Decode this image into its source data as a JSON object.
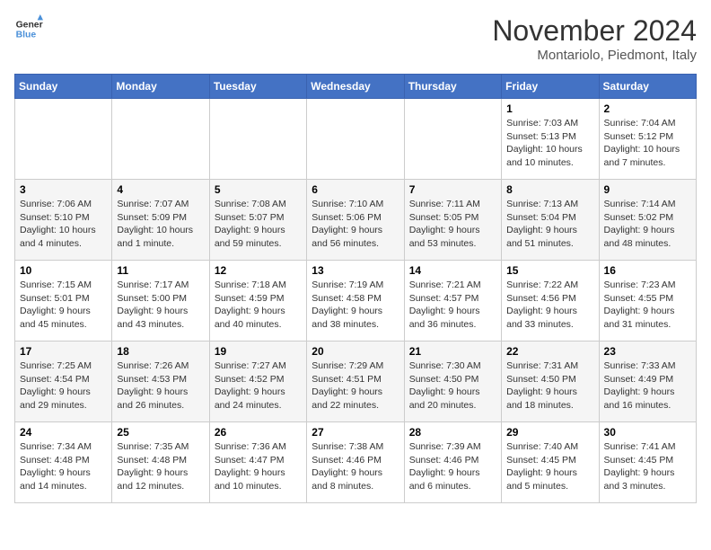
{
  "header": {
    "logo_line1": "General",
    "logo_line2": "Blue",
    "month": "November 2024",
    "location": "Montariolo, Piedmont, Italy"
  },
  "weekdays": [
    "Sunday",
    "Monday",
    "Tuesday",
    "Wednesday",
    "Thursday",
    "Friday",
    "Saturday"
  ],
  "weeks": [
    [
      {
        "day": "",
        "info": ""
      },
      {
        "day": "",
        "info": ""
      },
      {
        "day": "",
        "info": ""
      },
      {
        "day": "",
        "info": ""
      },
      {
        "day": "",
        "info": ""
      },
      {
        "day": "1",
        "info": "Sunrise: 7:03 AM\nSunset: 5:13 PM\nDaylight: 10 hours and 10 minutes."
      },
      {
        "day": "2",
        "info": "Sunrise: 7:04 AM\nSunset: 5:12 PM\nDaylight: 10 hours and 7 minutes."
      }
    ],
    [
      {
        "day": "3",
        "info": "Sunrise: 7:06 AM\nSunset: 5:10 PM\nDaylight: 10 hours and 4 minutes."
      },
      {
        "day": "4",
        "info": "Sunrise: 7:07 AM\nSunset: 5:09 PM\nDaylight: 10 hours and 1 minute."
      },
      {
        "day": "5",
        "info": "Sunrise: 7:08 AM\nSunset: 5:07 PM\nDaylight: 9 hours and 59 minutes."
      },
      {
        "day": "6",
        "info": "Sunrise: 7:10 AM\nSunset: 5:06 PM\nDaylight: 9 hours and 56 minutes."
      },
      {
        "day": "7",
        "info": "Sunrise: 7:11 AM\nSunset: 5:05 PM\nDaylight: 9 hours and 53 minutes."
      },
      {
        "day": "8",
        "info": "Sunrise: 7:13 AM\nSunset: 5:04 PM\nDaylight: 9 hours and 51 minutes."
      },
      {
        "day": "9",
        "info": "Sunrise: 7:14 AM\nSunset: 5:02 PM\nDaylight: 9 hours and 48 minutes."
      }
    ],
    [
      {
        "day": "10",
        "info": "Sunrise: 7:15 AM\nSunset: 5:01 PM\nDaylight: 9 hours and 45 minutes."
      },
      {
        "day": "11",
        "info": "Sunrise: 7:17 AM\nSunset: 5:00 PM\nDaylight: 9 hours and 43 minutes."
      },
      {
        "day": "12",
        "info": "Sunrise: 7:18 AM\nSunset: 4:59 PM\nDaylight: 9 hours and 40 minutes."
      },
      {
        "day": "13",
        "info": "Sunrise: 7:19 AM\nSunset: 4:58 PM\nDaylight: 9 hours and 38 minutes."
      },
      {
        "day": "14",
        "info": "Sunrise: 7:21 AM\nSunset: 4:57 PM\nDaylight: 9 hours and 36 minutes."
      },
      {
        "day": "15",
        "info": "Sunrise: 7:22 AM\nSunset: 4:56 PM\nDaylight: 9 hours and 33 minutes."
      },
      {
        "day": "16",
        "info": "Sunrise: 7:23 AM\nSunset: 4:55 PM\nDaylight: 9 hours and 31 minutes."
      }
    ],
    [
      {
        "day": "17",
        "info": "Sunrise: 7:25 AM\nSunset: 4:54 PM\nDaylight: 9 hours and 29 minutes."
      },
      {
        "day": "18",
        "info": "Sunrise: 7:26 AM\nSunset: 4:53 PM\nDaylight: 9 hours and 26 minutes."
      },
      {
        "day": "19",
        "info": "Sunrise: 7:27 AM\nSunset: 4:52 PM\nDaylight: 9 hours and 24 minutes."
      },
      {
        "day": "20",
        "info": "Sunrise: 7:29 AM\nSunset: 4:51 PM\nDaylight: 9 hours and 22 minutes."
      },
      {
        "day": "21",
        "info": "Sunrise: 7:30 AM\nSunset: 4:50 PM\nDaylight: 9 hours and 20 minutes."
      },
      {
        "day": "22",
        "info": "Sunrise: 7:31 AM\nSunset: 4:50 PM\nDaylight: 9 hours and 18 minutes."
      },
      {
        "day": "23",
        "info": "Sunrise: 7:33 AM\nSunset: 4:49 PM\nDaylight: 9 hours and 16 minutes."
      }
    ],
    [
      {
        "day": "24",
        "info": "Sunrise: 7:34 AM\nSunset: 4:48 PM\nDaylight: 9 hours and 14 minutes."
      },
      {
        "day": "25",
        "info": "Sunrise: 7:35 AM\nSunset: 4:48 PM\nDaylight: 9 hours and 12 minutes."
      },
      {
        "day": "26",
        "info": "Sunrise: 7:36 AM\nSunset: 4:47 PM\nDaylight: 9 hours and 10 minutes."
      },
      {
        "day": "27",
        "info": "Sunrise: 7:38 AM\nSunset: 4:46 PM\nDaylight: 9 hours and 8 minutes."
      },
      {
        "day": "28",
        "info": "Sunrise: 7:39 AM\nSunset: 4:46 PM\nDaylight: 9 hours and 6 minutes."
      },
      {
        "day": "29",
        "info": "Sunrise: 7:40 AM\nSunset: 4:45 PM\nDaylight: 9 hours and 5 minutes."
      },
      {
        "day": "30",
        "info": "Sunrise: 7:41 AM\nSunset: 4:45 PM\nDaylight: 9 hours and 3 minutes."
      }
    ]
  ]
}
